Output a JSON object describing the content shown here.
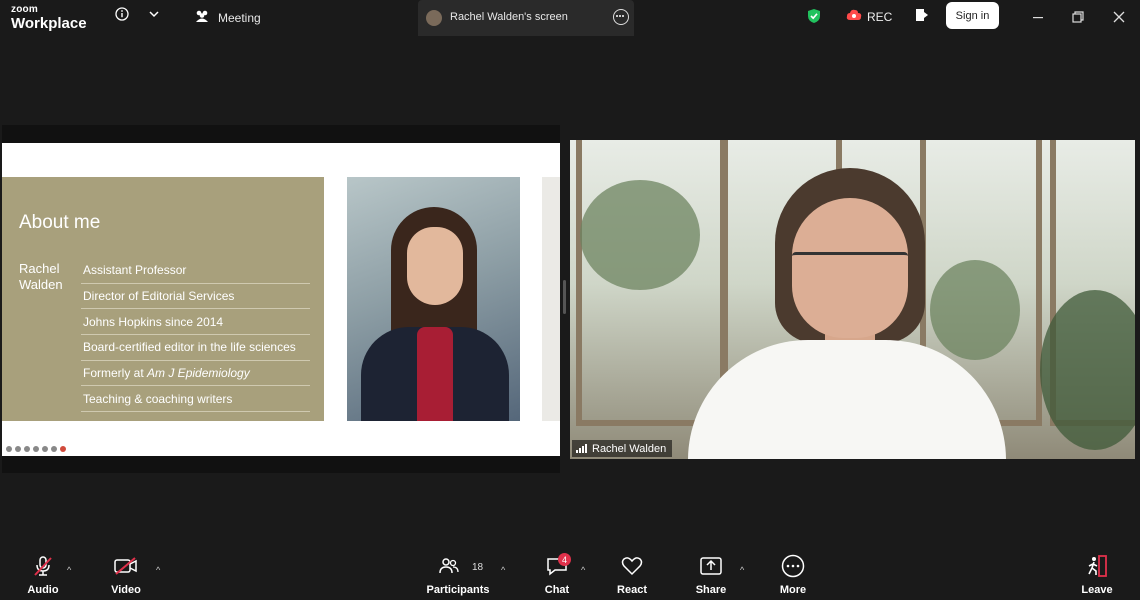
{
  "app": {
    "brand_small": "zoom",
    "brand_large": "Workplace"
  },
  "topbar": {
    "meeting_label": "Meeting",
    "share_tab_label": "Rachel Walden's screen",
    "rec_label": "REC",
    "signin_label": "Sign in",
    "icons": [
      "info-icon",
      "chevron-down-icon",
      "meeting-icon",
      "more-icon",
      "shield-icon",
      "record-icon",
      "leave-share-icon",
      "minimize-icon",
      "restore-icon",
      "close-icon"
    ]
  },
  "slide": {
    "title": "About me",
    "person": "Rachel\nWalden",
    "items": [
      {
        "text": "Assistant Professor"
      },
      {
        "text": "Director of Editorial Services"
      },
      {
        "text": "Johns Hopkins since 2014"
      },
      {
        "text": "Board-certified editor in the life sciences"
      },
      {
        "prefix": "Formerly at ",
        "emph": "Am J Epidemiology"
      },
      {
        "text": "Teaching & coaching writers"
      }
    ]
  },
  "video": {
    "participant_name": "Rachel Walden"
  },
  "controls": {
    "audio": "Audio",
    "video": "Video",
    "participants": "Participants",
    "participants_count": "18",
    "chat": "Chat",
    "chat_badge": "4",
    "react": "React",
    "share": "Share",
    "more": "More",
    "leave": "Leave"
  },
  "colors": {
    "slide_panel": "#a8a07c",
    "badge": "#e0314b",
    "shield": "#21c25e",
    "rec": "#ff4a4a"
  }
}
